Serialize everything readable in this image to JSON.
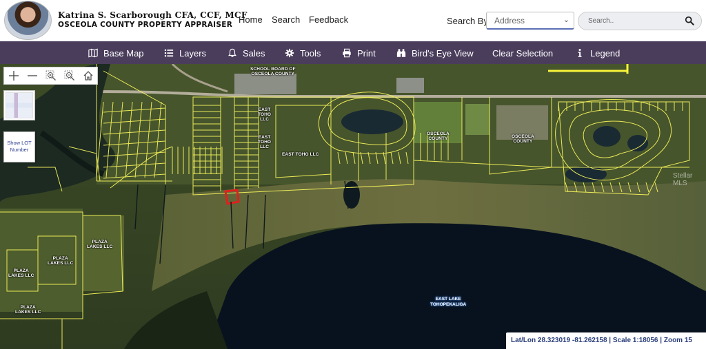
{
  "header": {
    "brand_name": "Katrina S. Scarborough CFA, CCF, MCF",
    "brand_sub": "OSCEOLA COUNTY PROPERTY APPRAISER",
    "nav": {
      "home": "Home",
      "search": "Search",
      "feedback": "Feedback"
    },
    "search_by_label": "Search By",
    "search_by_value": "Address",
    "search_placeholder": "Search.."
  },
  "toolbar": {
    "base_map": "Base Map",
    "layers": "Layers",
    "sales": "Sales",
    "tools": "Tools",
    "print": "Print",
    "birds_eye": "Bird's Eye View",
    "clear_selection": "Clear Selection",
    "legend": "Legend"
  },
  "map": {
    "show_lot_line1": "Show LOT",
    "show_lot_line2": "Number",
    "labels": {
      "school_board_1": "SCHOOL BOARD OF",
      "school_board_2": "OSCEOLA COUNTY",
      "east_toho_a1": "EAST",
      "east_toho_a2": "TOHO",
      "east_toho_a3": "LLC",
      "east_toho_b1": "EAST",
      "east_toho_b2": "TOHO",
      "east_toho_b3": "LLC",
      "east_toho_llc": "EAST TOHO LLC",
      "osceola_a1": "OSCEOLA",
      "osceola_a2": "COUNTY",
      "osceola_b1": "OSCEOLA",
      "osceola_b2": "COUNTY",
      "plaza_a1": "PLAZA",
      "plaza_a2": "LAKES LLC",
      "plaza_b1": "PLAZA",
      "plaza_b2": "LAKES LLC",
      "plaza_c1": "PLAZA",
      "plaza_c2": "LAKES LLC",
      "plaza_d1": "PLAZA",
      "plaza_d2": "LAKES LLC",
      "lake_1": "EAST LAKE",
      "lake_2": "TOHOPEKALIGA"
    },
    "watermark": "Stellar MLS",
    "status": "Lat/Lon 28.323019 -81.262158 | Scale 1:18056 | Zoom 15"
  },
  "colors": {
    "toolbar_bg": "#4a3d5c",
    "parcel_line": "#f3f25a",
    "selected_parcel": "#e0201c",
    "lake": "#08121f"
  },
  "icons": [
    "user-photo",
    "search-icon",
    "map-icon",
    "layers-icon",
    "bell-icon",
    "gear-icon",
    "printer-icon",
    "binoculars-icon",
    "info-icon",
    "zoom-in-icon",
    "zoom-out-icon",
    "zoom-box-in-icon",
    "zoom-box-out-icon",
    "home-icon",
    "chevron-down-icon"
  ]
}
